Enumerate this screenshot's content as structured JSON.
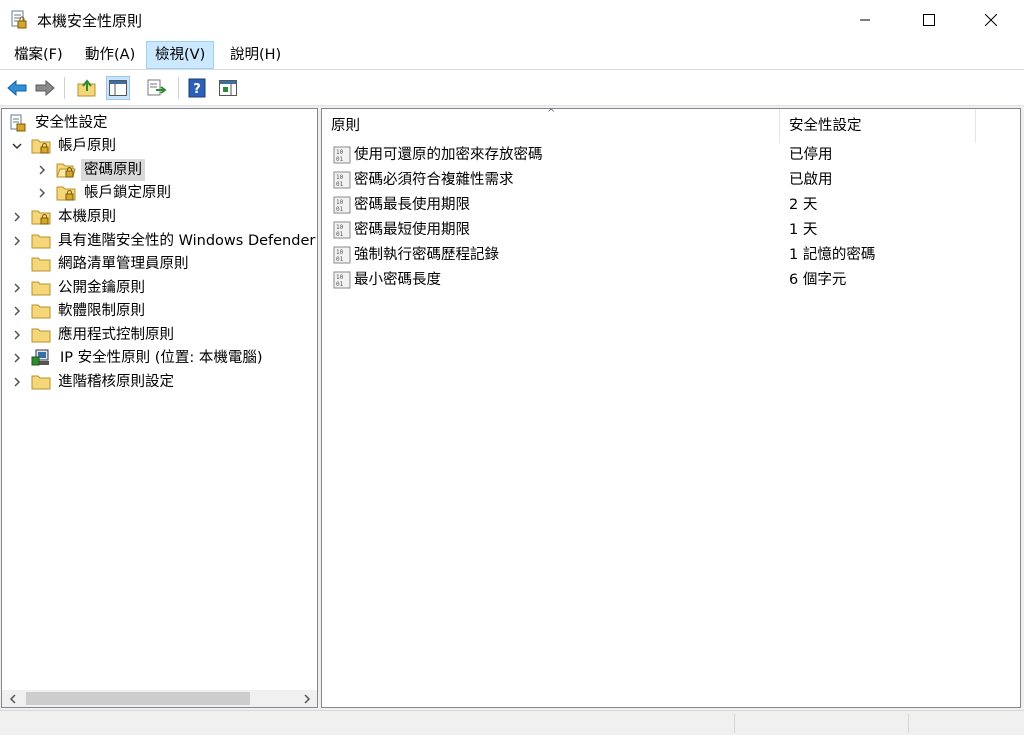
{
  "window": {
    "title": "本機安全性原則"
  },
  "menu": [
    {
      "label": "檔案(F)"
    },
    {
      "label": "動作(A)"
    },
    {
      "label": "檢視(V)"
    },
    {
      "label": "說明(H)"
    }
  ],
  "toolbar": {
    "icons": [
      "back-arrow-icon",
      "forward-arrow-icon",
      "up-folder-icon",
      "show-hide-tree-icon",
      "export-list-icon",
      "help-icon",
      "properties-pane-icon"
    ]
  },
  "tree": {
    "items": [
      {
        "label": "安全性設定"
      },
      {
        "label": "帳戶原則"
      },
      {
        "label": "密碼原則"
      },
      {
        "label": "帳戶鎖定原則"
      },
      {
        "label": "本機原則"
      },
      {
        "label": "具有進階安全性的 Windows Defender 防火牆"
      },
      {
        "label": "網路清單管理員原則"
      },
      {
        "label": "公開金鑰原則"
      },
      {
        "label": "軟體限制原則"
      },
      {
        "label": "應用程式控制原則"
      },
      {
        "label": "IP 安全性原則 (位置: 本機電腦)"
      },
      {
        "label": "進階稽核原則設定"
      }
    ]
  },
  "list": {
    "columns": [
      "原則",
      "安全性設定"
    ],
    "rows": [
      {
        "policy": "使用可還原的加密來存放密碼",
        "setting": "已停用"
      },
      {
        "policy": "密碼必須符合複雜性需求",
        "setting": "已啟用"
      },
      {
        "policy": "密碼最長使用期限",
        "setting": "2 天"
      },
      {
        "policy": "密碼最短使用期限",
        "setting": "1 天"
      },
      {
        "policy": "強制執行密碼歷程記錄",
        "setting": "1 記憶的密碼"
      },
      {
        "policy": "最小密碼長度",
        "setting": "6 個字元"
      }
    ]
  },
  "colors": {
    "selection": "#cce8ff",
    "accent": "#1979ca",
    "folder": "#f5d77a"
  }
}
